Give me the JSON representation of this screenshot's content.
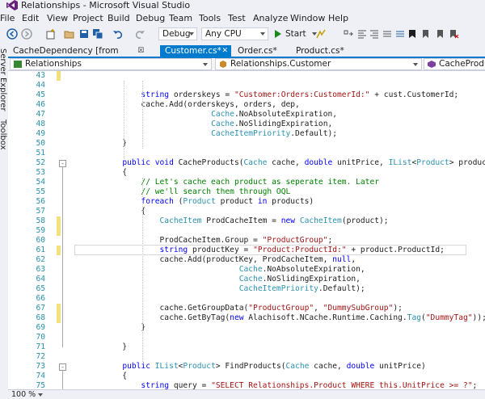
{
  "window": {
    "title": "Relationships - Microsoft Visual Studio"
  },
  "menu": [
    "File",
    "Edit",
    "View",
    "Project",
    "Build",
    "Debug",
    "Team",
    "Tools",
    "Test",
    "Analyze",
    "Window",
    "Help"
  ],
  "toolbar": {
    "configuration": "Debug",
    "platform": "Any CPU",
    "start_label": "Start"
  },
  "side_panels": [
    "Server Explorer",
    "Toolbox"
  ],
  "tabs": [
    {
      "label": "CacheDependency [from metadata]",
      "active": false
    },
    {
      "label": "Customer.cs*",
      "active": true
    },
    {
      "label": "Order.cs*",
      "active": false
    },
    {
      "label": "Product.cs*",
      "active": false
    }
  ],
  "navigation": {
    "project": "Relationships",
    "class": "Relationships.Customer",
    "member": "CacheProducts(C"
  },
  "editor": {
    "lines": [
      {
        "n": "43",
        "changed": true,
        "tokens": []
      },
      {
        "n": "44",
        "changed": false,
        "tokens": []
      },
      {
        "n": "45",
        "changed": false,
        "tokens": [
          [
            "",
            "                "
          ],
          [
            "kw",
            "string"
          ],
          [
            "",
            " orderskeys = "
          ],
          [
            "str",
            "\"Customer:Orders:CustomerId:\""
          ],
          [
            "",
            " + cust.CustomerId;"
          ]
        ]
      },
      {
        "n": "46",
        "changed": false,
        "tokens": [
          [
            "",
            "                cache.Add(orderskeys, orders, dep,"
          ]
        ]
      },
      {
        "n": "47",
        "changed": false,
        "tokens": [
          [
            "",
            "                               "
          ],
          [
            "ty",
            "Cache"
          ],
          [
            "",
            ".NoAbsoluteExpiration,"
          ]
        ]
      },
      {
        "n": "48",
        "changed": false,
        "tokens": [
          [
            "",
            "                               "
          ],
          [
            "ty",
            "Cache"
          ],
          [
            "",
            ".NoSlidingExpiration,"
          ]
        ]
      },
      {
        "n": "49",
        "changed": false,
        "tokens": [
          [
            "",
            "                               "
          ],
          [
            "ty",
            "CacheItemPriority"
          ],
          [
            "",
            ".Default);"
          ]
        ]
      },
      {
        "n": "50",
        "changed": false,
        "tokens": [
          [
            "",
            "            }"
          ]
        ]
      },
      {
        "n": "51",
        "changed": false,
        "tokens": []
      },
      {
        "n": "52",
        "changed": false,
        "tokens": [
          [
            "",
            "            "
          ],
          [
            "kw",
            "public"
          ],
          [
            "",
            " "
          ],
          [
            "kw",
            "void"
          ],
          [
            "",
            " CacheProducts("
          ],
          [
            "ty",
            "Cache"
          ],
          [
            "",
            " cache, "
          ],
          [
            "kw",
            "double"
          ],
          [
            "",
            " unitPrice, "
          ],
          [
            "ty",
            "IList"
          ],
          [
            "",
            "<"
          ],
          [
            "ty",
            "Product"
          ],
          [
            "",
            "> products)"
          ]
        ]
      },
      {
        "n": "53",
        "changed": false,
        "tokens": [
          [
            "",
            "            {"
          ]
        ]
      },
      {
        "n": "54",
        "changed": false,
        "tokens": [
          [
            "",
            "                "
          ],
          [
            "cm",
            "// Let's cache each product as seperate item. Later"
          ]
        ]
      },
      {
        "n": "55",
        "changed": false,
        "tokens": [
          [
            "",
            "                "
          ],
          [
            "cm",
            "// we'll search them through OQL"
          ]
        ]
      },
      {
        "n": "56",
        "changed": false,
        "tokens": [
          [
            "",
            "                "
          ],
          [
            "kw",
            "foreach"
          ],
          [
            "",
            " ("
          ],
          [
            "ty",
            "Product"
          ],
          [
            "",
            " product "
          ],
          [
            "kw",
            "in"
          ],
          [
            "",
            " products)"
          ]
        ]
      },
      {
        "n": "57",
        "changed": false,
        "tokens": [
          [
            "",
            "                {"
          ]
        ]
      },
      {
        "n": "58",
        "changed": true,
        "tokens": [
          [
            "",
            "                    "
          ],
          [
            "ty",
            "CacheItem"
          ],
          [
            "",
            " ProdCacheItem = "
          ],
          [
            "kw",
            "new"
          ],
          [
            "",
            " "
          ],
          [
            "ty",
            "CacheItem"
          ],
          [
            "",
            "(product);"
          ]
        ]
      },
      {
        "n": "59",
        "changed": true,
        "tokens": []
      },
      {
        "n": "60",
        "changed": false,
        "tokens": [
          [
            "",
            "                    ProdCacheItem.Group = "
          ],
          [
            "str",
            "\"ProductGroup\""
          ],
          [
            "",
            ";"
          ]
        ]
      },
      {
        "n": "61",
        "changed": true,
        "tokens": [
          [
            "",
            "                    "
          ],
          [
            "kw",
            "string"
          ],
          [
            "",
            " productKey = "
          ],
          [
            "str",
            "\"Product:ProductId:\""
          ],
          [
            "",
            " + product.ProductId;"
          ]
        ]
      },
      {
        "n": "62",
        "changed": false,
        "tokens": [
          [
            "",
            "                    cache.Add(productKey, ProdCacheItem, "
          ],
          [
            "kw",
            "null"
          ],
          [
            "",
            ","
          ]
        ]
      },
      {
        "n": "63",
        "changed": false,
        "tokens": [
          [
            "",
            "                                     "
          ],
          [
            "ty",
            "Cache"
          ],
          [
            "",
            ".NoAbsoluteExpiration,"
          ]
        ]
      },
      {
        "n": "64",
        "changed": false,
        "tokens": [
          [
            "",
            "                                     "
          ],
          [
            "ty",
            "Cache"
          ],
          [
            "",
            ".NoSlidingExpiration,"
          ]
        ]
      },
      {
        "n": "65",
        "changed": false,
        "tokens": [
          [
            "",
            "                                     "
          ],
          [
            "ty",
            "CacheItemPriority"
          ],
          [
            "",
            ".Default);"
          ]
        ]
      },
      {
        "n": "66",
        "changed": false,
        "tokens": []
      },
      {
        "n": "67",
        "changed": true,
        "tokens": [
          [
            "",
            "                    cache.GetGroupData("
          ],
          [
            "str",
            "\"ProductGroup\""
          ],
          [
            "",
            ", "
          ],
          [
            "str",
            "\"DummySubGroup\""
          ],
          [
            "",
            ");"
          ]
        ]
      },
      {
        "n": "68",
        "changed": true,
        "tokens": [
          [
            "",
            "                    cache.GetByTag("
          ],
          [
            "kw",
            "new"
          ],
          [
            "",
            " Alachisoft.NCache.Runtime.Caching."
          ],
          [
            "ty",
            "Tag"
          ],
          [
            "",
            "("
          ],
          [
            "str",
            "\"DummyTag\""
          ],
          [
            "",
            "));"
          ]
        ]
      },
      {
        "n": "69",
        "changed": false,
        "tokens": [
          [
            "",
            "                }"
          ]
        ]
      },
      {
        "n": "70",
        "changed": false,
        "tokens": []
      },
      {
        "n": "71",
        "changed": false,
        "tokens": [
          [
            "",
            "            }"
          ]
        ]
      },
      {
        "n": "72",
        "changed": false,
        "tokens": []
      },
      {
        "n": "73",
        "changed": false,
        "tokens": [
          [
            "",
            "            "
          ],
          [
            "kw",
            "public"
          ],
          [
            "",
            " "
          ],
          [
            "ty",
            "IList"
          ],
          [
            "",
            "<"
          ],
          [
            "ty",
            "Product"
          ],
          [
            "",
            "> FindProducts("
          ],
          [
            "ty",
            "Cache"
          ],
          [
            "",
            " cache, "
          ],
          [
            "kw",
            "double"
          ],
          [
            "",
            " unitPrice)"
          ]
        ]
      },
      {
        "n": "74",
        "changed": false,
        "tokens": [
          [
            "",
            "            {"
          ]
        ]
      },
      {
        "n": "75",
        "changed": false,
        "tokens": [
          [
            "",
            "                "
          ],
          [
            "kw",
            "string"
          ],
          [
            "",
            " query = "
          ],
          [
            "str",
            "\"SELECT Relationships.Product WHERE this.UnitPrice >= ?\""
          ],
          [
            "",
            ";"
          ]
        ]
      }
    ]
  },
  "status": {
    "zoom": "100 %"
  },
  "colors": {
    "accent": "#007acc",
    "keyword": "#0000ff",
    "type": "#2b91af",
    "string": "#a31515",
    "comment": "#008000",
    "changed_margin": "#efe27c"
  }
}
